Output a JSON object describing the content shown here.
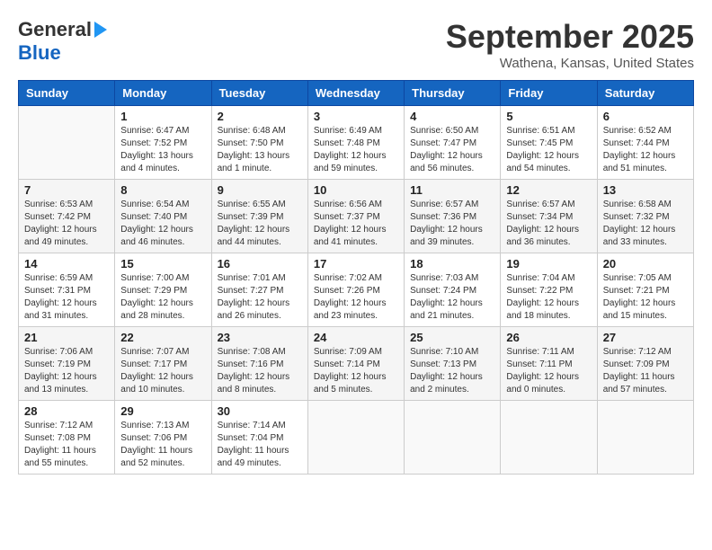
{
  "header": {
    "logo_general": "General",
    "logo_blue": "Blue",
    "month_title": "September 2025",
    "location": "Wathena, Kansas, United States"
  },
  "weekdays": [
    "Sunday",
    "Monday",
    "Tuesday",
    "Wednesday",
    "Thursday",
    "Friday",
    "Saturday"
  ],
  "weeks": [
    [
      {
        "day": "",
        "info": ""
      },
      {
        "day": "1",
        "info": "Sunrise: 6:47 AM\nSunset: 7:52 PM\nDaylight: 13 hours\nand 4 minutes."
      },
      {
        "day": "2",
        "info": "Sunrise: 6:48 AM\nSunset: 7:50 PM\nDaylight: 13 hours\nand 1 minute."
      },
      {
        "day": "3",
        "info": "Sunrise: 6:49 AM\nSunset: 7:48 PM\nDaylight: 12 hours\nand 59 minutes."
      },
      {
        "day": "4",
        "info": "Sunrise: 6:50 AM\nSunset: 7:47 PM\nDaylight: 12 hours\nand 56 minutes."
      },
      {
        "day": "5",
        "info": "Sunrise: 6:51 AM\nSunset: 7:45 PM\nDaylight: 12 hours\nand 54 minutes."
      },
      {
        "day": "6",
        "info": "Sunrise: 6:52 AM\nSunset: 7:44 PM\nDaylight: 12 hours\nand 51 minutes."
      }
    ],
    [
      {
        "day": "7",
        "info": "Sunrise: 6:53 AM\nSunset: 7:42 PM\nDaylight: 12 hours\nand 49 minutes."
      },
      {
        "day": "8",
        "info": "Sunrise: 6:54 AM\nSunset: 7:40 PM\nDaylight: 12 hours\nand 46 minutes."
      },
      {
        "day": "9",
        "info": "Sunrise: 6:55 AM\nSunset: 7:39 PM\nDaylight: 12 hours\nand 44 minutes."
      },
      {
        "day": "10",
        "info": "Sunrise: 6:56 AM\nSunset: 7:37 PM\nDaylight: 12 hours\nand 41 minutes."
      },
      {
        "day": "11",
        "info": "Sunrise: 6:57 AM\nSunset: 7:36 PM\nDaylight: 12 hours\nand 39 minutes."
      },
      {
        "day": "12",
        "info": "Sunrise: 6:57 AM\nSunset: 7:34 PM\nDaylight: 12 hours\nand 36 minutes."
      },
      {
        "day": "13",
        "info": "Sunrise: 6:58 AM\nSunset: 7:32 PM\nDaylight: 12 hours\nand 33 minutes."
      }
    ],
    [
      {
        "day": "14",
        "info": "Sunrise: 6:59 AM\nSunset: 7:31 PM\nDaylight: 12 hours\nand 31 minutes."
      },
      {
        "day": "15",
        "info": "Sunrise: 7:00 AM\nSunset: 7:29 PM\nDaylight: 12 hours\nand 28 minutes."
      },
      {
        "day": "16",
        "info": "Sunrise: 7:01 AM\nSunset: 7:27 PM\nDaylight: 12 hours\nand 26 minutes."
      },
      {
        "day": "17",
        "info": "Sunrise: 7:02 AM\nSunset: 7:26 PM\nDaylight: 12 hours\nand 23 minutes."
      },
      {
        "day": "18",
        "info": "Sunrise: 7:03 AM\nSunset: 7:24 PM\nDaylight: 12 hours\nand 21 minutes."
      },
      {
        "day": "19",
        "info": "Sunrise: 7:04 AM\nSunset: 7:22 PM\nDaylight: 12 hours\nand 18 minutes."
      },
      {
        "day": "20",
        "info": "Sunrise: 7:05 AM\nSunset: 7:21 PM\nDaylight: 12 hours\nand 15 minutes."
      }
    ],
    [
      {
        "day": "21",
        "info": "Sunrise: 7:06 AM\nSunset: 7:19 PM\nDaylight: 12 hours\nand 13 minutes."
      },
      {
        "day": "22",
        "info": "Sunrise: 7:07 AM\nSunset: 7:17 PM\nDaylight: 12 hours\nand 10 minutes."
      },
      {
        "day": "23",
        "info": "Sunrise: 7:08 AM\nSunset: 7:16 PM\nDaylight: 12 hours\nand 8 minutes."
      },
      {
        "day": "24",
        "info": "Sunrise: 7:09 AM\nSunset: 7:14 PM\nDaylight: 12 hours\nand 5 minutes."
      },
      {
        "day": "25",
        "info": "Sunrise: 7:10 AM\nSunset: 7:13 PM\nDaylight: 12 hours\nand 2 minutes."
      },
      {
        "day": "26",
        "info": "Sunrise: 7:11 AM\nSunset: 7:11 PM\nDaylight: 12 hours\nand 0 minutes."
      },
      {
        "day": "27",
        "info": "Sunrise: 7:12 AM\nSunset: 7:09 PM\nDaylight: 11 hours\nand 57 minutes."
      }
    ],
    [
      {
        "day": "28",
        "info": "Sunrise: 7:12 AM\nSunset: 7:08 PM\nDaylight: 11 hours\nand 55 minutes."
      },
      {
        "day": "29",
        "info": "Sunrise: 7:13 AM\nSunset: 7:06 PM\nDaylight: 11 hours\nand 52 minutes."
      },
      {
        "day": "30",
        "info": "Sunrise: 7:14 AM\nSunset: 7:04 PM\nDaylight: 11 hours\nand 49 minutes."
      },
      {
        "day": "",
        "info": ""
      },
      {
        "day": "",
        "info": ""
      },
      {
        "day": "",
        "info": ""
      },
      {
        "day": "",
        "info": ""
      }
    ]
  ]
}
